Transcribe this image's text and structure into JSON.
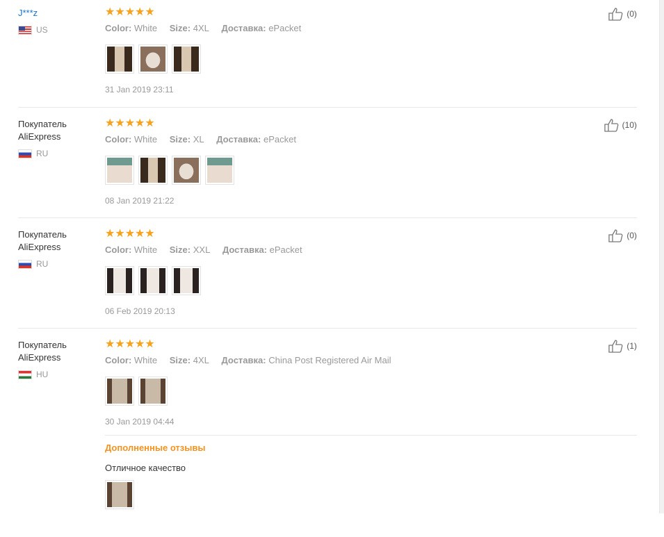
{
  "reviews": [
    {
      "user": "J***z",
      "country": "US",
      "rating_stars": "★★★★★",
      "color_label": "Color:",
      "color": "White",
      "size_label": "Size:",
      "size": "4XL",
      "ship_label": "Доставка:",
      "ship": "ePacket",
      "date": "31 Jan 2019 23:11",
      "likes": "(0)"
    },
    {
      "user_line1": "Покупатель",
      "user_line2": "AliExpress",
      "country": "RU",
      "rating_stars": "★★★★★",
      "color_label": "Color:",
      "color": "White",
      "size_label": "Size:",
      "size": "XL",
      "ship_label": "Доставка:",
      "ship": "ePacket",
      "date": "08 Jan 2019 21:22",
      "likes": "(10)"
    },
    {
      "user_line1": "Покупатель",
      "user_line2": "AliExpress",
      "country": "RU",
      "rating_stars": "★★★★★",
      "color_label": "Color:",
      "color": "White",
      "size_label": "Size:",
      "size": "XXL",
      "ship_label": "Доставка:",
      "ship": "ePacket",
      "date": "06 Feb 2019 20:13",
      "likes": "(0)"
    },
    {
      "user_line1": "Покупатель",
      "user_line2": "AliExpress",
      "country": "HU",
      "rating_stars": "★★★★★",
      "color_label": "Color:",
      "color": "White",
      "size_label": "Size:",
      "size": "4XL",
      "ship_label": "Доставка:",
      "ship": "China Post Registered Air Mail",
      "date": "30 Jan 2019 04:44",
      "likes": "(1)",
      "additional_title": "Дополненные отзывы",
      "additional_text": "Отличное качество"
    }
  ],
  "icons": {
    "like": "thumbs-up-icon"
  },
  "colors": {
    "stars": "#f7a21a",
    "additional_title": "#f5921f",
    "user_link": "#1a73c8"
  }
}
